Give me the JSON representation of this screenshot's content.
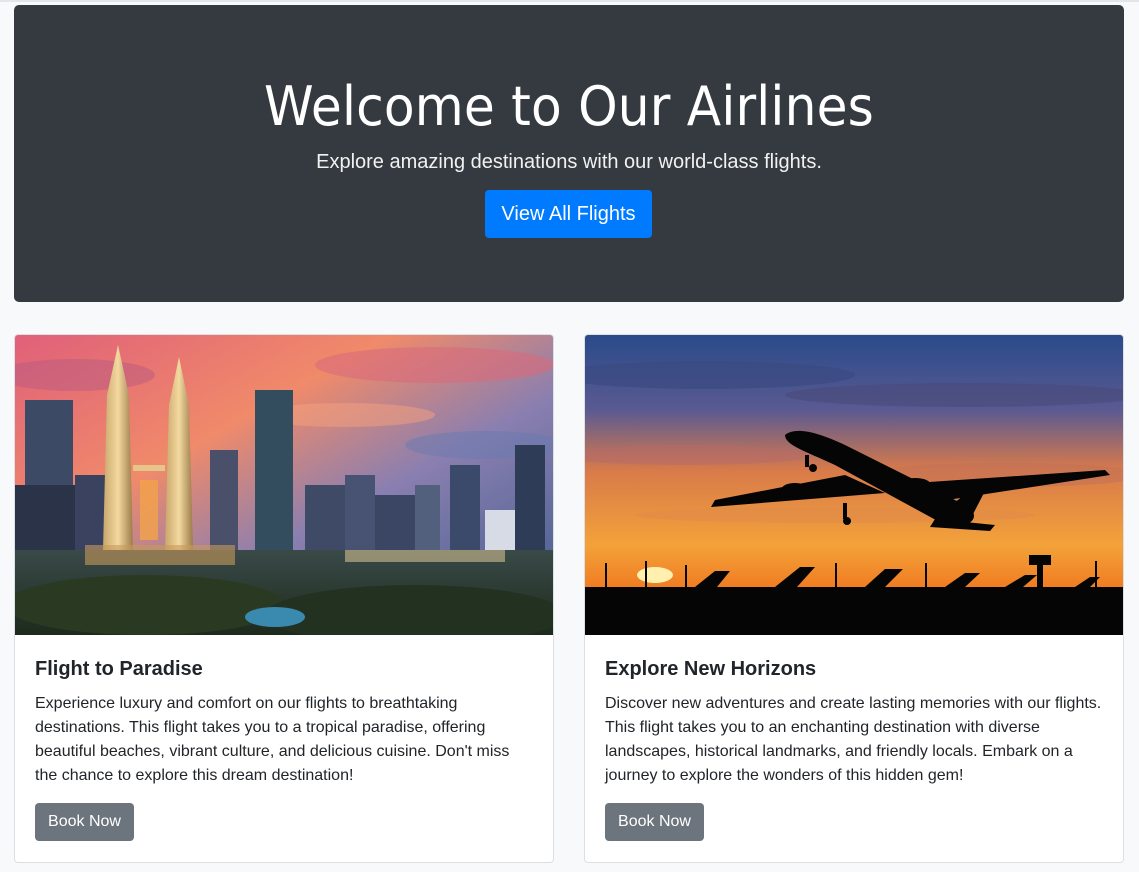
{
  "hero": {
    "title": "Welcome to Our Airlines",
    "subtitle": "Explore amazing destinations with our world-class flights.",
    "button_label": "View All Flights"
  },
  "cards": [
    {
      "title": "Flight to Paradise",
      "text": "Experience luxury and comfort on our flights to breathtaking destinations. This flight takes you to a tropical paradise, offering beautiful beaches, vibrant culture, and delicious cuisine. Don't miss the chance to explore this dream destination!",
      "button_label": "Book Now",
      "image": "city-skyline-at-dusk"
    },
    {
      "title": "Explore New Horizons",
      "text": "Discover new adventures and create lasting memories with our flights. This flight takes you to an enchanting destination with diverse landscapes, historical landmarks, and friendly locals. Embark on a journey to explore the wonders of this hidden gem!",
      "button_label": "Book Now",
      "image": "airplane-silhouette-at-sunset"
    }
  ],
  "colors": {
    "hero_bg": "#343a40",
    "primary": "#007bff",
    "secondary": "#6c757d",
    "page_bg": "#f8f9fa"
  }
}
